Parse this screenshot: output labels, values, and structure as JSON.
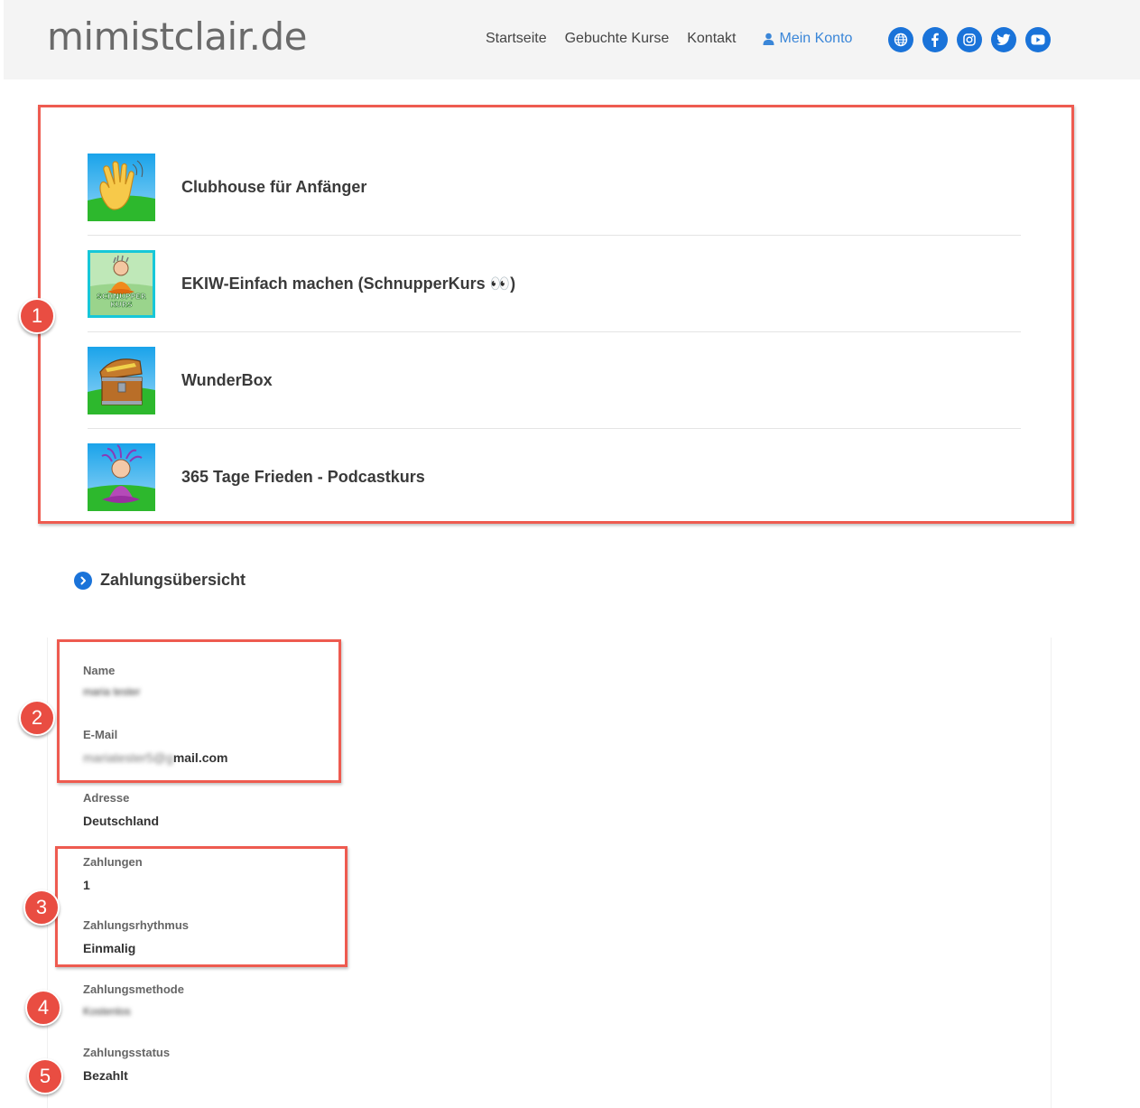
{
  "header": {
    "logo": "mimistclair.de",
    "nav": [
      "Startseite",
      "Gebuchte Kurse",
      "Kontakt"
    ],
    "account_label": "Mein Konto",
    "socials": [
      "globe-icon",
      "facebook-icon",
      "instagram-icon",
      "twitter-icon",
      "youtube-icon"
    ],
    "accent": "#1a73d9"
  },
  "courses": [
    {
      "title": "Clubhouse für Anfänger",
      "thumb": "waving-hand"
    },
    {
      "title": "EKIW-Einfach machen (SchnupperKurs 👀)",
      "thumb": "schnupperkurs-figure",
      "thumb_text": "SCHNUPPER KURS"
    },
    {
      "title": "WunderBox",
      "thumb": "treasure-chest"
    },
    {
      "title": "365 Tage Frieden - Podcastkurs",
      "thumb": "meditating-figure"
    }
  ],
  "badges": [
    "1",
    "2",
    "3",
    "4",
    "5"
  ],
  "payment": {
    "section_title": "Zahlungsübersicht",
    "fields": [
      {
        "label": "Name",
        "value": "maria tester",
        "blurred": true
      },
      {
        "label": "E-Mail",
        "value_blurred": "mariatester5@g",
        "value_clear": "mail.com"
      },
      {
        "label": "Adresse",
        "value": "Deutschland"
      },
      {
        "label": "Zahlungen",
        "value": "1"
      },
      {
        "label": "Zahlungsrhythmus",
        "value": "Einmalig"
      },
      {
        "label": "Zahlungsmethode",
        "value": "Kostenlos",
        "blurred": true
      },
      {
        "label": "Zahlungsstatus",
        "value": "Bezahlt"
      }
    ]
  },
  "highlight_color": "#ee5b50"
}
